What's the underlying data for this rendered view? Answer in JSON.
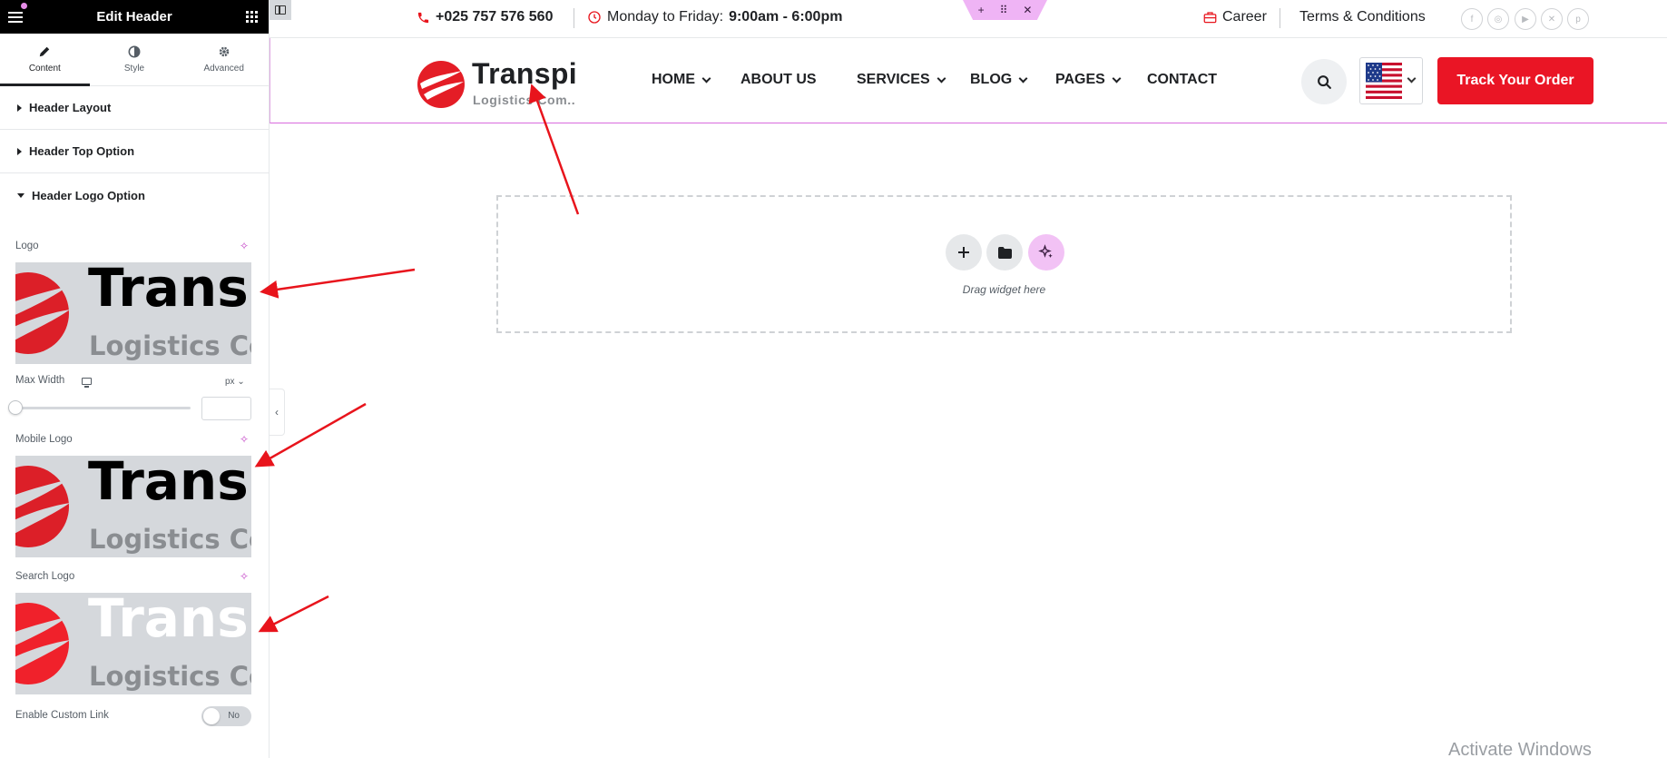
{
  "panel": {
    "title": "Edit Header",
    "tabs": [
      {
        "label": "Content",
        "icon": "pencil-icon",
        "active": true
      },
      {
        "label": "Style",
        "icon": "contrast-icon",
        "active": false
      },
      {
        "label": "Advanced",
        "icon": "gear-icon",
        "active": false
      }
    ],
    "sections": [
      {
        "label": "Header Layout",
        "open": false
      },
      {
        "label": "Header Top Option",
        "open": false
      },
      {
        "label": "Header Logo Option",
        "open": true
      }
    ],
    "controls": {
      "logo_label": "Logo",
      "max_width_label": "Max Width",
      "max_width_unit": "px",
      "max_width_value": "",
      "mobile_logo_label": "Mobile Logo",
      "search_logo_label": "Search Logo",
      "custom_link_label": "Enable Custom Link",
      "custom_link_toggle": "No"
    },
    "logo_preview": {
      "name": "Trans",
      "sub": "Logistics Co"
    }
  },
  "topbar": {
    "phone": "+025 757 576 560",
    "hours_prefix": "Monday to Friday:",
    "hours": "9:00am - 6:00pm",
    "career": "Career",
    "terms": "Terms & Conditions",
    "social_icons": [
      "facebook-icon",
      "instagram-icon",
      "youtube-icon",
      "x-twitter-icon",
      "pinterest-icon"
    ]
  },
  "header": {
    "brand_name": "Transpi",
    "brand_sub": "Logistics Com..",
    "menu": [
      {
        "label": "HOME",
        "dropdown": true
      },
      {
        "label": "ABOUT US",
        "dropdown": false
      },
      {
        "label": "SERVICES",
        "dropdown": true
      },
      {
        "label": "BLOG",
        "dropdown": true
      },
      {
        "label": "PAGES",
        "dropdown": true
      },
      {
        "label": "CONTACT",
        "dropdown": false
      }
    ],
    "cta": "Track Your Order"
  },
  "dropzone": {
    "text": "Drag widget here"
  },
  "watermark": "Activate Windows",
  "colors": {
    "brand_red": "#ea1525",
    "editor_pink": "#efb4f5",
    "panel_black": "#000000"
  }
}
